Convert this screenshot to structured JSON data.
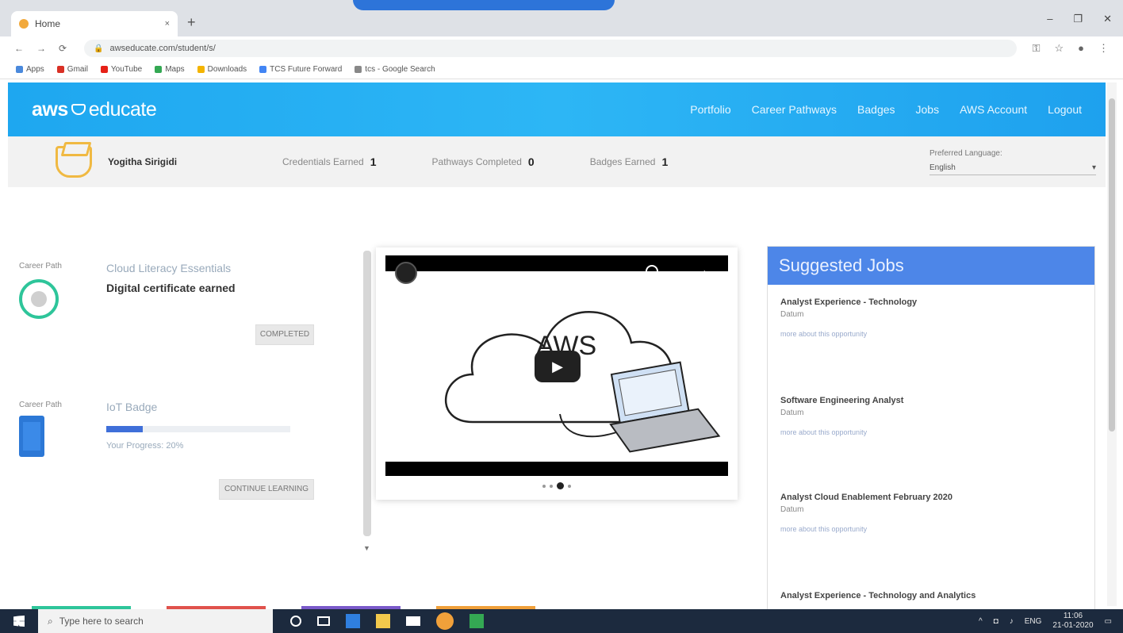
{
  "browser": {
    "tab_title": "Home",
    "tab_close": "×",
    "new_tab": "+",
    "url": "awseducate.com/student/s/",
    "window_controls": [
      "–",
      "❐",
      "✕"
    ],
    "bookmarks": [
      {
        "label": "Apps",
        "color": "#4a89dc"
      },
      {
        "label": "Gmail",
        "color": "#d93025"
      },
      {
        "label": "YouTube",
        "color": "#e62117"
      },
      {
        "label": "Maps",
        "color": "#34a853"
      },
      {
        "label": "Downloads",
        "color": "#f4b400"
      },
      {
        "label": "TCS Future Forward",
        "color": "#4285f4"
      },
      {
        "label": "tcs - Google Search",
        "color": "#888888"
      }
    ]
  },
  "header": {
    "logo_aws": "aws",
    "logo_educate": "educate",
    "nav": [
      "Portfolio",
      "Career Pathways",
      "Badges",
      "Jobs",
      "AWS Account",
      "Logout"
    ]
  },
  "profile": {
    "name": "Yogitha Sirigidi",
    "stats": [
      {
        "label": "Credentials Earned",
        "value": "1"
      },
      {
        "label": "Pathways Completed",
        "value": "0"
      },
      {
        "label": "Badges Earned",
        "value": "1"
      }
    ],
    "language_label": "Preferred Language:",
    "language_value": "English"
  },
  "career_paths": [
    {
      "label": "Career Path",
      "title": "Cloud Literacy Essentials",
      "subtitle": "Digital certificate earned",
      "button": "COMPLETED"
    },
    {
      "label": "Career Path",
      "title": "IoT Badge",
      "progress_text": "Your Progress: 20%",
      "progress": 0.2,
      "button": "CONTINUE LEARNING"
    }
  ],
  "video": {
    "scroll_arrow": "▼",
    "play_label": "▶"
  },
  "jobs": {
    "heading": "Suggested Jobs",
    "items": [
      {
        "title": "Analyst Experience - Technology",
        "company": "Datum",
        "link": "more about this opportunity"
      },
      {
        "title": "Software Engineering Analyst",
        "company": "Datum",
        "link": "more about this opportunity"
      },
      {
        "title": "Analyst Cloud Enablement February 2020",
        "company": "Datum",
        "link": "more about this opportunity"
      },
      {
        "title": "Analyst Experience - Technology and Analytics",
        "company": "",
        "link": ""
      }
    ]
  },
  "taskbar": {
    "search_placeholder": "Type here to search",
    "lang": "ENG",
    "time": "11:06",
    "date": "21-01-2020"
  }
}
